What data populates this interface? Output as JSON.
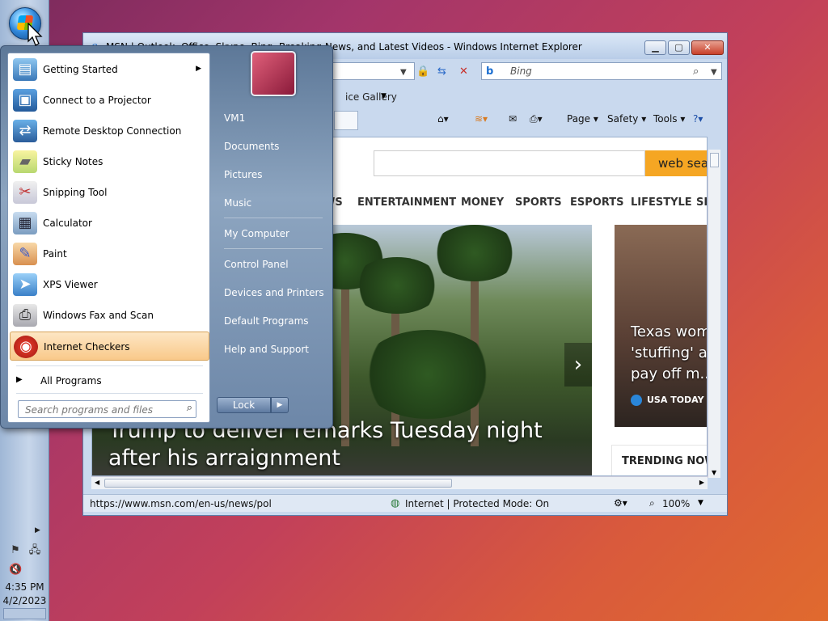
{
  "taskbar": {
    "clock_time": "4:35 PM",
    "clock_date": "4/2/2023",
    "tray_icons": [
      "action-center-flag-icon",
      "network-icon",
      "volume-muted-icon"
    ]
  },
  "ie": {
    "title": "MSN | Outlook, Office, Skype, Bing, Breaking News, and Latest Videos - Windows Internet Explorer",
    "search_placeholder": "Bing",
    "favorites_text": "ice Gallery",
    "commands": {
      "page": "Page",
      "safety": "Safety",
      "tools": "Tools"
    },
    "page": {
      "web_search_label": "web search",
      "nav": [
        "WS",
        "ENTERTAINMENT",
        "MONEY",
        "SPORTS",
        "ESPORTS",
        "LIFESTYLE",
        "SH"
      ],
      "hero_caption": "Trump to deliver remarks Tuesday night after his arraignment",
      "side_title": "Texas woman's 'stuffing' and ... to pay off m...",
      "side_source": "USA TODAY",
      "trending_label": "TRENDING NOW"
    },
    "status": {
      "url": "https://www.msn.com/en-us/news/politics",
      "zone": "Internet | Protected Mode: On",
      "zoom": "100%"
    }
  },
  "start_menu": {
    "programs": [
      {
        "label": "Getting Started",
        "icon": "getting-started-icon",
        "has_submenu": true
      },
      {
        "label": "Connect to a Projector",
        "icon": "projector-icon",
        "has_submenu": false
      },
      {
        "label": "Remote Desktop Connection",
        "icon": "remote-desktop-icon",
        "has_submenu": false
      },
      {
        "label": "Sticky Notes",
        "icon": "sticky-notes-icon",
        "has_submenu": false
      },
      {
        "label": "Snipping Tool",
        "icon": "snipping-tool-icon",
        "has_submenu": false
      },
      {
        "label": "Calculator",
        "icon": "calculator-icon",
        "has_submenu": false
      },
      {
        "label": "Paint",
        "icon": "paint-icon",
        "has_submenu": false
      },
      {
        "label": "XPS Viewer",
        "icon": "xps-viewer-icon",
        "has_submenu": false
      },
      {
        "label": "Windows Fax and Scan",
        "icon": "fax-scan-icon",
        "has_submenu": false
      },
      {
        "label": "Internet Checkers",
        "icon": "internet-checkers-icon",
        "has_submenu": false
      }
    ],
    "all_programs": "All Programs",
    "search_placeholder": "Search programs and files",
    "right_items": [
      "VM1",
      "Documents",
      "Pictures",
      "Music",
      "My Computer",
      "Control Panel",
      "Devices and Printers",
      "Default Programs",
      "Help and Support"
    ],
    "lock_label": "Lock"
  }
}
